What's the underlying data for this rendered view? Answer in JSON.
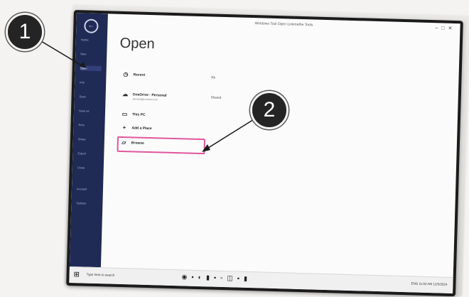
{
  "window": {
    "title": "Windows Tool Open Linkmethe Tools"
  },
  "window_controls": [
    "–",
    "□",
    "✕"
  ],
  "nav_rail": {
    "items": [
      "Home",
      "New",
      "Open",
      "Info",
      "Save",
      "Save as",
      "Print",
      "Share",
      "Export",
      "Close",
      "Account",
      "Options"
    ],
    "active_index": 2
  },
  "page": {
    "heading": "Open",
    "rows": [
      {
        "icon": "clock-icon",
        "label": "Recent",
        "side": "Rk"
      },
      {
        "icon": "cloud-icon",
        "label": "OneDrive - Personal",
        "sub": "alexdoe@contoso.com",
        "side": "Shared"
      },
      {
        "icon": "pc-icon",
        "label": "This PC"
      },
      {
        "icon": "plus-icon",
        "label": "Add a Place"
      },
      {
        "icon": "folder-icon",
        "label": "Browse"
      }
    ]
  },
  "annotations": {
    "callout_1": "1",
    "callout_2": "2"
  },
  "taskbar": {
    "search_placeholder": "Type here to search",
    "tray_text": "ENG 11:02 AM 12/5/2024"
  }
}
